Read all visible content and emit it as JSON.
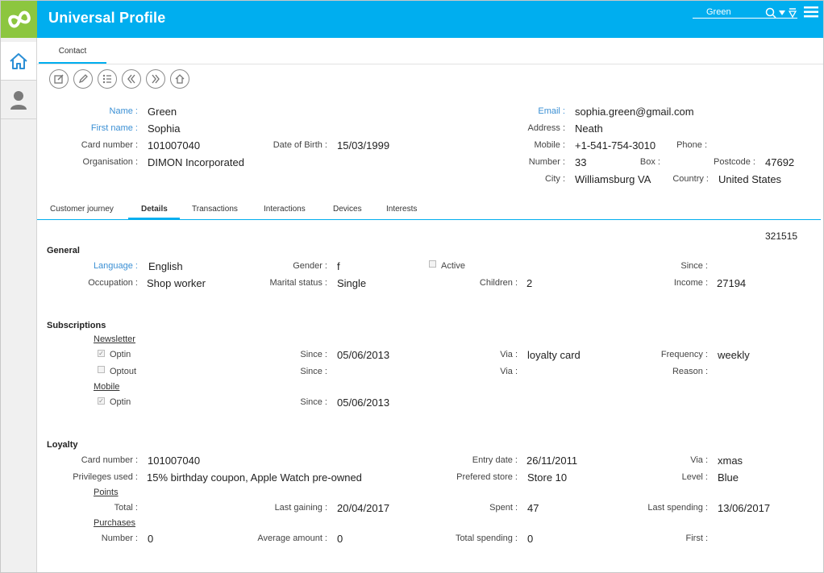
{
  "header": {
    "title": "Universal Profile",
    "search_value": "Green"
  },
  "colors": {
    "accent": "#00aeef",
    "logo": "#8cc63f",
    "label_blue": "#3a8fd4"
  },
  "top_tabs": {
    "contact": "Contact"
  },
  "toolbar": {
    "icons": [
      "edit-doc-icon",
      "pencil-icon",
      "list-icon",
      "previous-icon",
      "next-icon",
      "home-icon"
    ]
  },
  "contact": {
    "name_label": "Name :",
    "name": "Green",
    "first_name_label": "First name :",
    "first_name": "Sophia",
    "card_label": "Card number :",
    "card": "101007040",
    "org_label": "Organisation :",
    "org": "DIMON Incorporated",
    "dob_label": "Date of Birth :",
    "dob": "15/03/1999",
    "email_label": "Email :",
    "email": "sophia.green@gmail.com",
    "address_label": "Address :",
    "address": "Neath",
    "mobile_label": "Mobile :",
    "mobile": "+1-541-754-3010",
    "phone_label": "Phone :",
    "number_label": "Number :",
    "number": "33",
    "box_label": "Box :",
    "postcode_label": "Postcode :",
    "postcode": "47692",
    "city_label": "City :",
    "city": "Williamsburg VA",
    "country_label": "Country :",
    "country": "United States"
  },
  "detail_tabs": [
    "Customer journey",
    "Details",
    "Transactions",
    "Interactions",
    "Devices",
    "Interests"
  ],
  "details": {
    "id": "321515",
    "general_title": "General",
    "language_label": "Language :",
    "language": "English",
    "gender_label": "Gender :",
    "gender": "f",
    "active_label": "Active",
    "since_label": "Since :",
    "occupation_label": "Occupation :",
    "occupation": "Shop worker",
    "marital_label": "Marital status :",
    "marital": "Single",
    "children_label": "Children :",
    "children": "2",
    "income_label": "Income :",
    "income": "27194"
  },
  "subscriptions": {
    "title": "Subscriptions",
    "newsletter": "Newsletter",
    "optin_label": "Optin",
    "optout_label": "Optout",
    "since_label": "Since :",
    "via_label": "Via :",
    "optin_since": "05/06/2013",
    "optin_via": "loyalty card",
    "frequency_label": "Frequency :",
    "frequency": "weekly",
    "reason_label": "Reason :",
    "mobile": "Mobile",
    "mobile_optin_label": "Optin",
    "mobile_since": "05/06/2013"
  },
  "loyalty": {
    "title": "Loyalty",
    "card_label": "Card number :",
    "card": "101007040",
    "entry_label": "Entry date :",
    "entry": "26/11/2011",
    "via_label": "Via :",
    "via": "xmas",
    "privileges_label": "Privileges used :",
    "privileges": "15% birthday coupon, Apple Watch pre-owned",
    "store_label": "Prefered store :",
    "store": "Store 10",
    "level_label": "Level :",
    "level": "Blue",
    "points": "Points",
    "total_label": "Total :",
    "last_gaining_label": "Last gaining :",
    "last_gaining": "20/04/2017",
    "spent_label": "Spent :",
    "spent": "47",
    "last_spending_label": "Last spending :",
    "last_spending": "13/06/2017",
    "purchases": "Purchases",
    "p_number_label": "Number :",
    "p_number": "0",
    "avg_label": "Average amount :",
    "avg": "0",
    "total_spending_label": "Total spending :",
    "total_spending": "0",
    "first_label": "First :"
  }
}
